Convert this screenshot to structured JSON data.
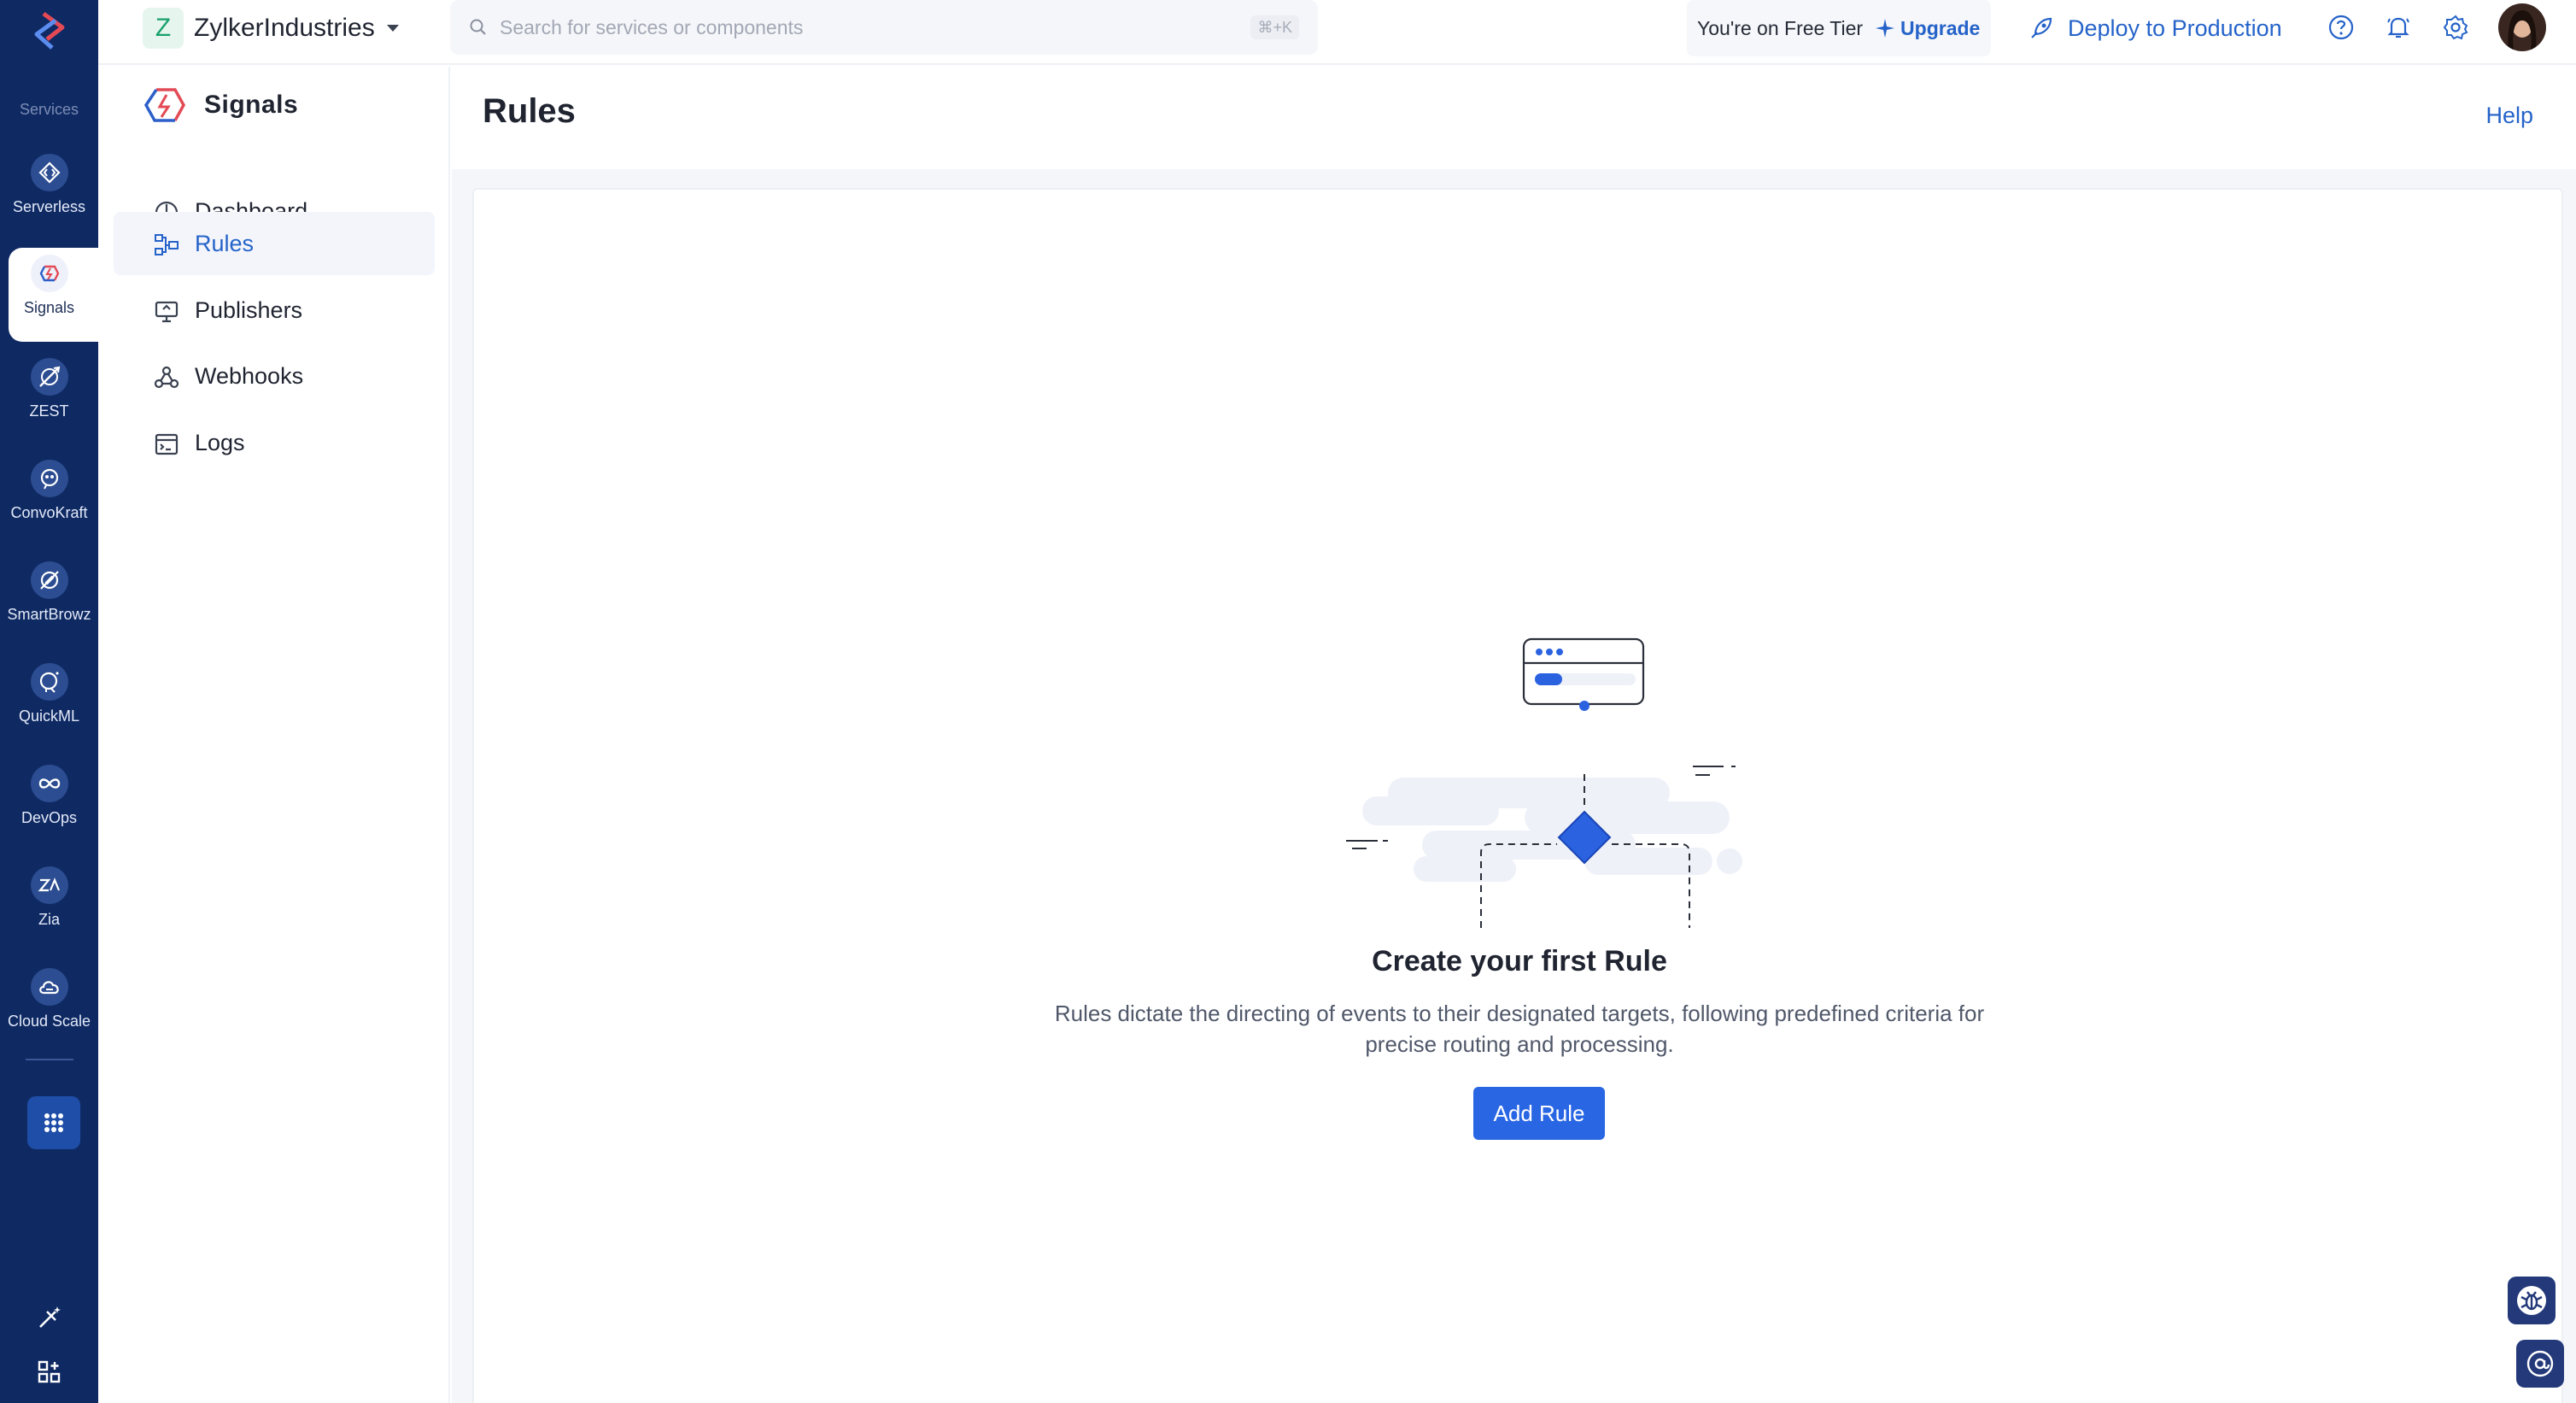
{
  "rail": {
    "heading": "Services",
    "items": [
      {
        "label": "Serverless",
        "icon": "code-diamond-icon"
      },
      {
        "label": "Signals",
        "icon": "signals-icon",
        "active": true
      },
      {
        "label": "ZEST",
        "icon": "zest-icon"
      },
      {
        "label": "ConvoKraft",
        "icon": "bot-face-icon"
      },
      {
        "label": "SmartBrowz",
        "icon": "compass-icon"
      },
      {
        "label": "QuickML",
        "icon": "ml-head-icon"
      },
      {
        "label": "DevOps",
        "icon": "infinity-icon"
      },
      {
        "label": "Zia",
        "icon": "zia-icon"
      },
      {
        "label": "Cloud Scale",
        "icon": "cloud-icon"
      }
    ]
  },
  "topbar": {
    "org_initial": "Z",
    "org_name": "ZylkerIndustries",
    "search_placeholder": "Search for services or components",
    "search_shortcut": "⌘+K",
    "tier_text": "You're on Free Tier",
    "upgrade_label": "Upgrade",
    "deploy_label": "Deploy to Production"
  },
  "sidebar": {
    "title": "Signals",
    "items": [
      {
        "label": "Dashboard",
        "icon": "dashboard-icon"
      },
      {
        "label": "Rules",
        "icon": "rules-icon",
        "active": true
      },
      {
        "label": "Publishers",
        "icon": "publishers-icon"
      },
      {
        "label": "Webhooks",
        "icon": "webhooks-icon"
      },
      {
        "label": "Logs",
        "icon": "logs-icon"
      }
    ]
  },
  "main": {
    "title": "Rules",
    "help_label": "Help",
    "empty_title": "Create your first Rule",
    "empty_desc_line1": "Rules dictate the directing of events to their designated targets, following predefined criteria for",
    "empty_desc_line2": "precise routing and processing.",
    "add_button_label": "Add Rule"
  },
  "colors": {
    "rail_bg": "#0f2a63",
    "accent": "#2563c9",
    "button": "#2966e3",
    "main_bg": "#f4f6fa"
  }
}
